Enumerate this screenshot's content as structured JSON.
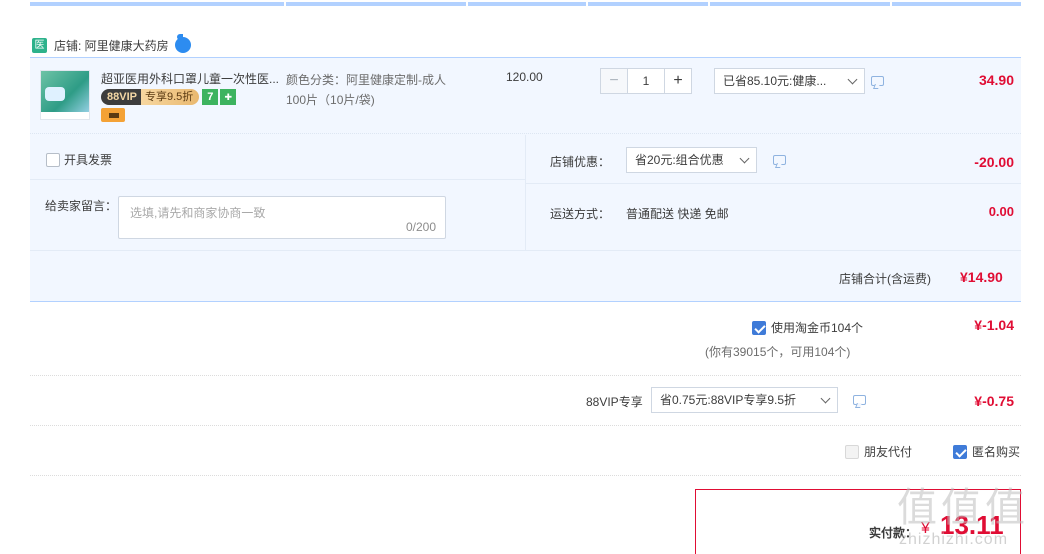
{
  "shop": {
    "icon_text": "医",
    "label": "店铺: 阿里健康大药房"
  },
  "item": {
    "title": "超亚医用外科口罩儿童一次性医...",
    "vip_left": "88VIP",
    "vip_right": "专享9.5折",
    "seven_days": "7",
    "spec": "颜色分类：阿里健康定制-成人 100片（10片/袋)",
    "price": "120.00",
    "quantity": "1",
    "discount_select": "已省85.10元:健康...",
    "subtotal": "34.90"
  },
  "invoice": {
    "label": "开具发票"
  },
  "memo": {
    "label": "给卖家留言：",
    "placeholder": "选填,请先和商家协商一致",
    "count": "0/200"
  },
  "shop_discount": {
    "label": "店铺优惠：",
    "select": "省20元:组合优惠",
    "amount": "-20.00"
  },
  "shipping": {
    "label": "运送方式：",
    "value": "普通配送 快递 免邮",
    "amount": "0.00"
  },
  "shop_total": {
    "label": "店铺合计(含运费)",
    "amount": "¥14.90"
  },
  "coins": {
    "label": "使用淘金币104个",
    "sub": "(你有39015个，可用104个)",
    "amount": "¥-1.04",
    "checked": true
  },
  "vip": {
    "label": "88VIP专享",
    "select": "省0.75元:88VIP专享9.5折",
    "amount": "¥-0.75"
  },
  "pay_options": {
    "friend": "朋友代付",
    "anonymous": "匿名购买"
  },
  "final": {
    "label": "实付款：",
    "yen": "¥",
    "amount": "13.11"
  },
  "watermark": {
    "glyphs": [
      "值",
      "值",
      "值"
    ],
    "text": "zhizhizhi.com"
  },
  "colors": {
    "accent_blue": "#3f7bd8",
    "price_red": "#e00d34",
    "row_bg": "#f2f7ff"
  }
}
